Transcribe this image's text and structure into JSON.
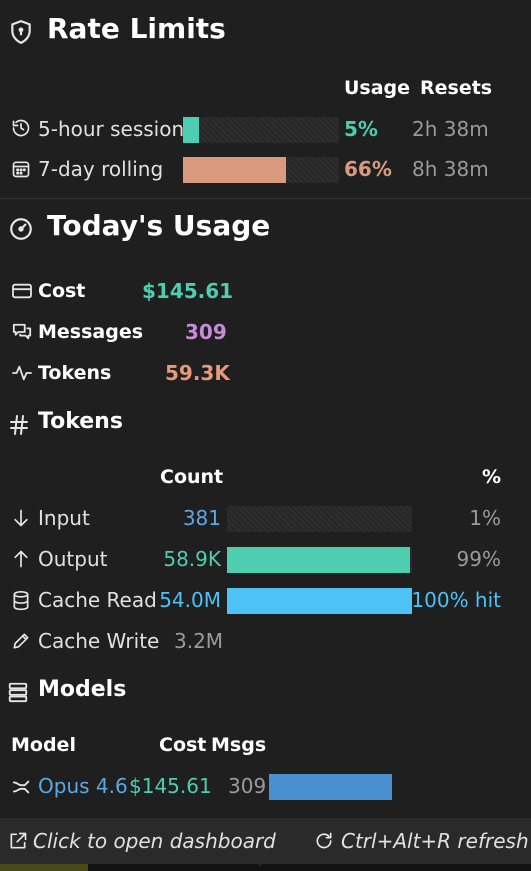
{
  "rate_limits": {
    "title": "Rate Limits",
    "col_usage": "Usage",
    "col_resets": "Resets",
    "rows": [
      {
        "label": "5-hour session",
        "usage": "5%",
        "usage_fraction": 0.05,
        "resets": "2h 38m",
        "color": "#4ecdb0"
      },
      {
        "label": "7-day rolling",
        "usage": "66%",
        "usage_fraction": 0.66,
        "resets": "8h 38m",
        "color": "#d99a80"
      }
    ]
  },
  "today": {
    "title": "Today's Usage",
    "cost_label": "Cost",
    "cost_value": "$145.61",
    "cost_color": "#4ecdb0",
    "messages_label": "Messages",
    "messages_value": "309",
    "messages_color": "#c98bd6",
    "tokens_label": "Tokens",
    "tokens_value": "59.3K",
    "tokens_color": "#e39a78"
  },
  "tokens": {
    "title": "Tokens",
    "col_count": "Count",
    "col_pct": "%",
    "rows": [
      {
        "label": "Input",
        "count": "381",
        "fraction": 0.0,
        "pct": "1%",
        "count_color": "#5aa9e6",
        "bar_color": "#4ecdb0",
        "pct_color": "#9a9a9a",
        "icon": "arrow-down-icon"
      },
      {
        "label": "Output",
        "count": "58.9K",
        "fraction": 0.99,
        "pct": "99%",
        "count_color": "#4ecdb0",
        "bar_color": "#4ecdb0",
        "pct_color": "#9a9a9a",
        "icon": "arrow-up-icon"
      },
      {
        "label": "Cache Read",
        "count": "54.0M",
        "fraction": 1.0,
        "pct": "100% hit",
        "count_color": "#4cc2f5",
        "bar_color": "#4cc2f5",
        "pct_color": "#4cc2f5",
        "icon": "database-icon"
      }
    ],
    "cache_write_label": "Cache Write",
    "cache_write_value": "3.2M"
  },
  "models": {
    "title": "Models",
    "col_model": "Model",
    "col_cost": "Cost",
    "col_msgs": "Msgs",
    "rows": [
      {
        "name": "Opus 4.6",
        "cost": "$145.61",
        "msgs": "309",
        "fraction": 1.0,
        "name_color": "#5aa9e6",
        "cost_color": "#4ecdb0",
        "bar_color": "#4a90d0"
      }
    ]
  },
  "footer": {
    "open_dashboard": "Click to open dashboard",
    "refresh": "Ctrl+Alt+R refresh"
  }
}
